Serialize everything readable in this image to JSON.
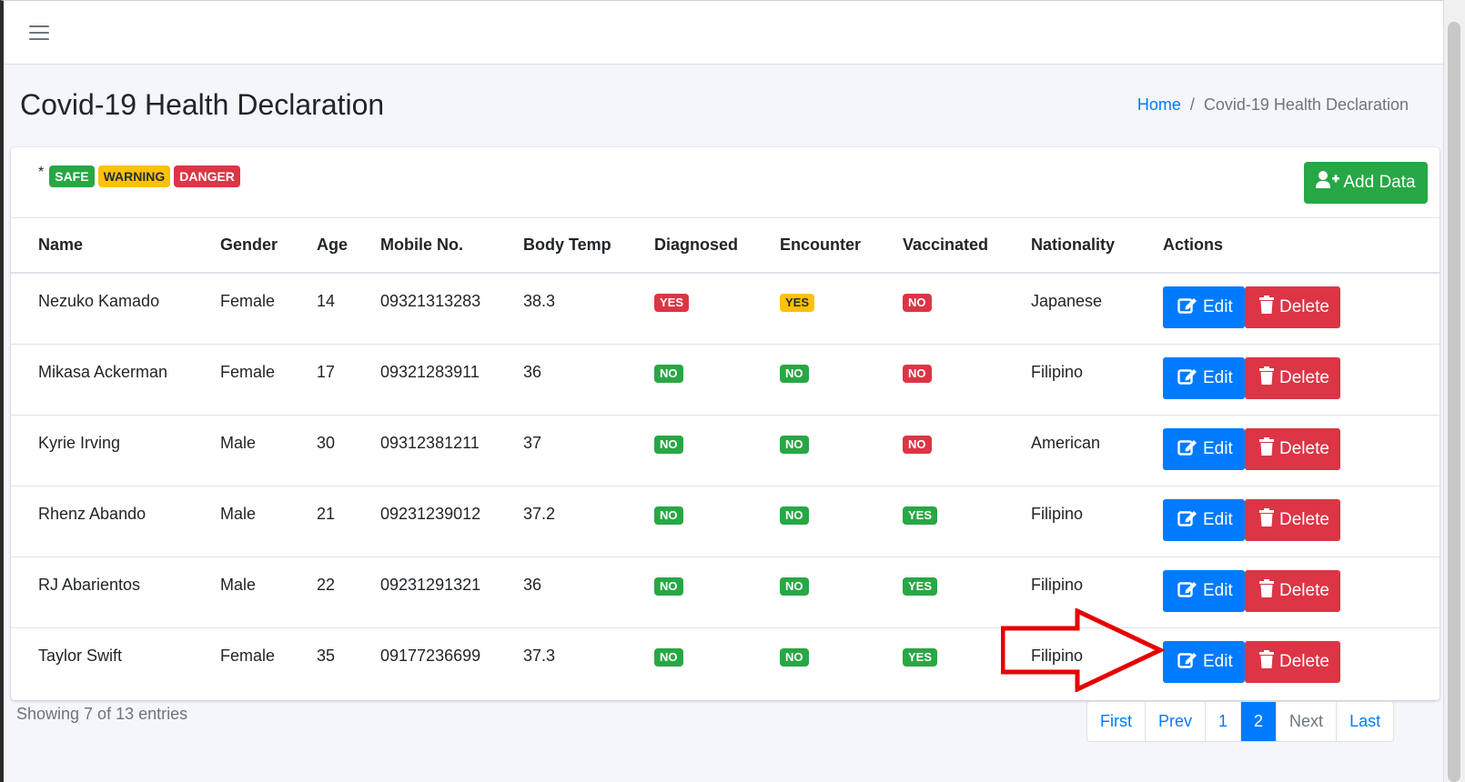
{
  "page": {
    "title": "Covid-19 Health Declaration",
    "breadcrumb": {
      "home": "Home",
      "separator": "/",
      "current": "Covid-19 Health Declaration"
    }
  },
  "legend": {
    "asterisk": "*",
    "safe": "SAFE",
    "warning": "WARNING",
    "danger": "DANGER"
  },
  "toolbar": {
    "add_label": "Add Data"
  },
  "table": {
    "headers": [
      "Name",
      "Gender",
      "Age",
      "Mobile No.",
      "Body Temp",
      "Diagnosed",
      "Encounter",
      "Vaccinated",
      "Nationality",
      "Actions"
    ],
    "rows": [
      {
        "name": "Nezuko Kamado",
        "gender": "Female",
        "age": "14",
        "mobile": "09321313283",
        "temp": "38.3",
        "diagnosed": "YES",
        "encounter": "YES",
        "vaccinated": "NO",
        "nationality": "Japanese"
      },
      {
        "name": "Mikasa Ackerman",
        "gender": "Female",
        "age": "17",
        "mobile": "09321283911",
        "temp": "36",
        "diagnosed": "NO",
        "encounter": "NO",
        "vaccinated": "NO",
        "nationality": "Filipino"
      },
      {
        "name": "Kyrie Irving",
        "gender": "Male",
        "age": "30",
        "mobile": "09312381211",
        "temp": "37",
        "diagnosed": "NO",
        "encounter": "NO",
        "vaccinated": "NO",
        "nationality": "American"
      },
      {
        "name": "Rhenz Abando",
        "gender": "Male",
        "age": "21",
        "mobile": "09231239012",
        "temp": "37.2",
        "diagnosed": "NO",
        "encounter": "NO",
        "vaccinated": "YES",
        "nationality": "Filipino"
      },
      {
        "name": "RJ Abarientos",
        "gender": "Male",
        "age": "22",
        "mobile": "09231291321",
        "temp": "36",
        "diagnosed": "NO",
        "encounter": "NO",
        "vaccinated": "YES",
        "nationality": "Filipino"
      },
      {
        "name": "Taylor Swift",
        "gender": "Female",
        "age": "35",
        "mobile": "09177236699",
        "temp": "37.3",
        "diagnosed": "NO",
        "encounter": "NO",
        "vaccinated": "YES",
        "nationality": "Filipino"
      }
    ],
    "edit_label": "Edit",
    "delete_label": "Delete"
  },
  "footer": {
    "entries_text": "Showing 7 of 13 entries",
    "pagination": [
      "First",
      "Prev",
      "1",
      "2",
      "Next",
      "Last"
    ],
    "active_page": "2"
  },
  "colors": {
    "primary": "#007bff",
    "success": "#28a745",
    "warning": "#ffc107",
    "danger": "#dc3545",
    "annotation_arrow": "#e60000"
  },
  "icons": {
    "menu": "hamburger-icon",
    "add": "user-plus-icon",
    "edit": "edit-icon",
    "delete": "trash-icon"
  }
}
